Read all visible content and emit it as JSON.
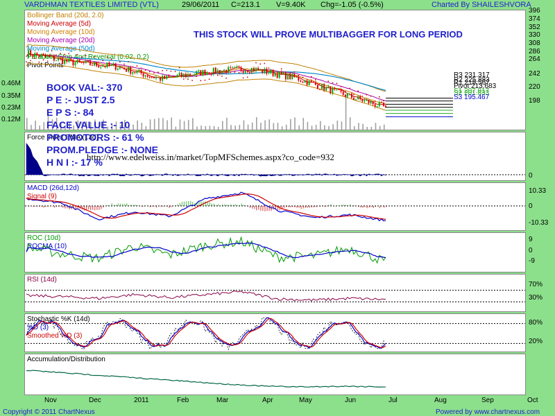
{
  "header": {
    "stock": "VARDHMAN TEXTILES LIMITED (VTL)",
    "date": "29/06/2011",
    "close": "C=213.1",
    "volume": "V=9.40K",
    "change": "Chg=-1.05 (-0.5%)",
    "charted_by": "Charted By SHAILESHVORA"
  },
  "legends": {
    "price": [
      {
        "label": "Bollinger Band (20d, 2.0)",
        "color": "#C08000"
      },
      {
        "label": "Moving Average (5d)",
        "color": "#CC0000"
      },
      {
        "label": "Moving Average (10d)",
        "color": "#D08000"
      },
      {
        "label": "Moving Average (20d)",
        "color": "#AA00AA"
      },
      {
        "label": "Moving Average (50d)",
        "color": "#0088CC"
      },
      {
        "label": "Parabolic Stop And Reversal (0.02, 0.2)",
        "color": "#009900"
      },
      {
        "label": "Pivot Points",
        "color": "#000000"
      }
    ],
    "force": "Force Index EMA (13d)",
    "macd": [
      "MACD (26d,12d)",
      "Signal (9)"
    ],
    "roc": [
      "ROC (10d)",
      "ROCMA (10)"
    ],
    "rsi": "RSI (14d)",
    "stoch": [
      "Stochastic %K (14d)",
      "%D (3)",
      "Smoothed %D (3)"
    ],
    "ad": "Accumulation/Distribution"
  },
  "annotations": {
    "headline": "THIS STOCK WILL PROVE MULTIBAGGER FOR LONG PERIOD",
    "url": "http://www.edelweiss.in/market/TopMFSchemes.aspx?co_code=932",
    "fundamentals": [
      "BOOK VAL:- 370",
      "P E :- JUST 2.5",
      "E P S :- 84",
      "FACE VALUE :- 10",
      "PROMOTORS :- 61 %",
      "PROM.PLEDGE :- NONE",
      "H N I :- 17 %"
    ]
  },
  "footer": {
    "copyright": "Copyright © 2011 ChartNexus",
    "powered": "Powered by www.chartnexus.com"
  },
  "chart_data": {
    "type": "line",
    "x_ticks": [
      "Nov",
      "Dec",
      "2011",
      "Feb",
      "Mar",
      "Apr",
      "May",
      "Jun",
      "Jul",
      "Aug",
      "Sep",
      "Oct"
    ],
    "price_panel": {
      "y_ticks": [
        396,
        374,
        352,
        330,
        308,
        286,
        264,
        242,
        220,
        198
      ],
      "ylim": [
        180,
        400
      ],
      "volume_ticks": [
        "0.46M",
        "0.35M",
        "0.23M",
        "0.12M"
      ],
      "close": [
        [
          "Nov",
          318
        ],
        [
          "Dec",
          300
        ],
        [
          "2011",
          292
        ],
        [
          "Feb",
          268
        ],
        [
          "Mar",
          282
        ],
        [
          "Apr",
          288
        ],
        [
          "May",
          270
        ],
        [
          "Jun",
          240
        ],
        [
          "Jun-end",
          213.1
        ]
      ],
      "pivot_points": [
        {
          "label": "R3 231.317",
          "value": 231.317
        },
        {
          "label": "R2 225.883",
          "value": 225.883
        },
        {
          "label": "R1 219.567",
          "value": 219.567
        },
        {
          "label": "Pivot 213.683",
          "value": 213.683
        },
        {
          "label": "S1 207.917",
          "value": 207.917
        },
        {
          "label": "S2 201.833",
          "value": 201.833
        },
        {
          "label": "S3 195.467",
          "value": 195.467
        }
      ]
    },
    "force_panel": {
      "y_ticks": [
        0
      ]
    },
    "macd_panel": {
      "y_ticks": [
        10.33,
        0,
        -10.33
      ],
      "ylim": [
        -16,
        16
      ]
    },
    "roc_panel": {
      "y_ticks": [
        9,
        0,
        -9
      ],
      "ylim": [
        -15,
        15
      ]
    },
    "rsi_panel": {
      "y_ticks": [
        "70%",
        "30%"
      ],
      "ylim": [
        0,
        100
      ]
    },
    "stoch_panel": {
      "y_ticks": [
        "80%",
        "20%"
      ],
      "ylim": [
        0,
        100
      ]
    }
  }
}
